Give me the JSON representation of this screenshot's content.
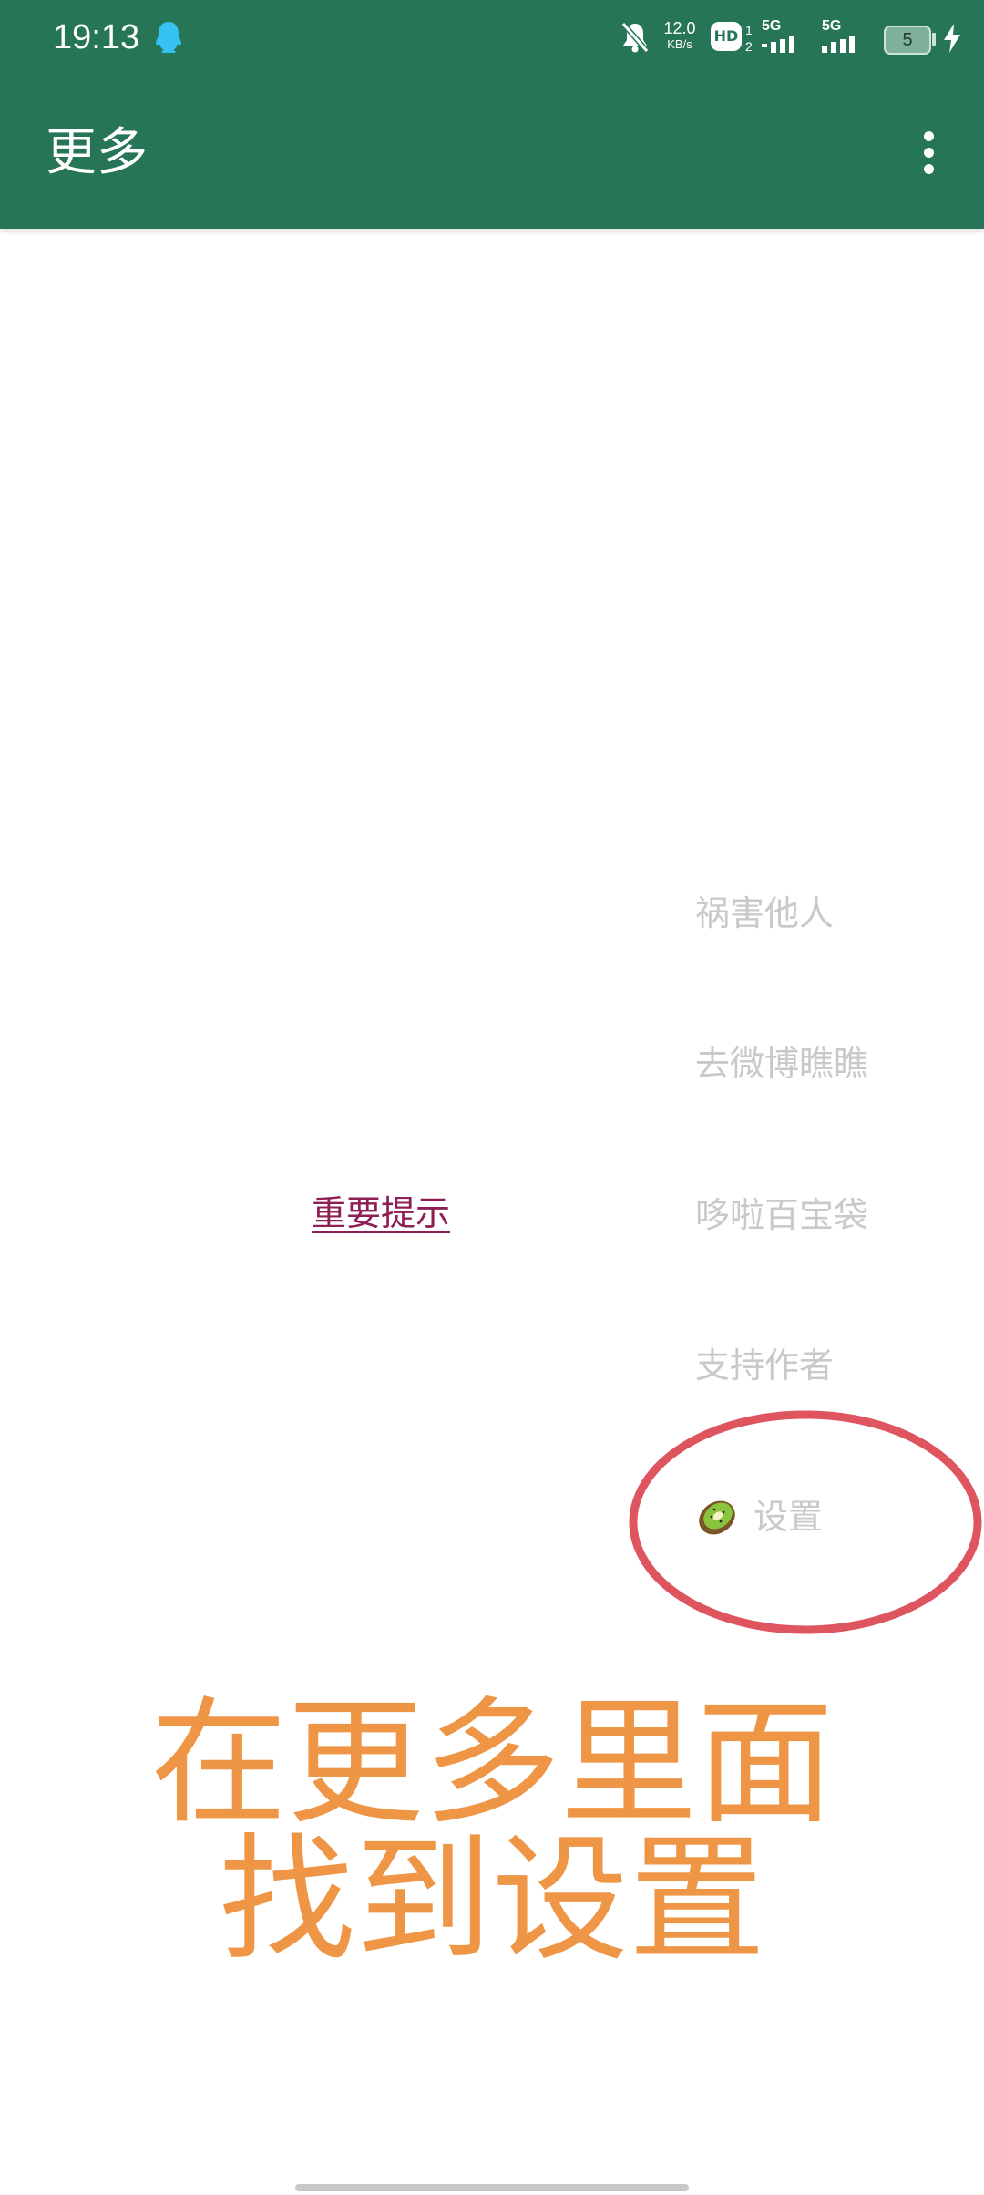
{
  "status_bar": {
    "time": "19:13",
    "net_speed_value": "12.0",
    "net_speed_unit": "KB/s",
    "hd_label": "HD",
    "sim1_label": "5G",
    "sim2_label": "5G",
    "battery_level": "5"
  },
  "app_bar": {
    "title": "更多"
  },
  "menu": {
    "items": [
      {
        "label": "祸害他人"
      },
      {
        "label": "去微博瞧瞧"
      },
      {
        "label": "哆啦百宝袋"
      },
      {
        "label": "支持作者"
      },
      {
        "label": "设置",
        "icon": "kiwi-icon"
      }
    ]
  },
  "hint_link": "重要提示",
  "annotation": {
    "line1": "在更多里面",
    "line2": "找到设置",
    "ring_color": "#de5560",
    "text_color": "#ee9646"
  },
  "colors": {
    "app_bar": "#267557",
    "menu_text": "#c9c9c9",
    "link": "#8e1f55"
  }
}
